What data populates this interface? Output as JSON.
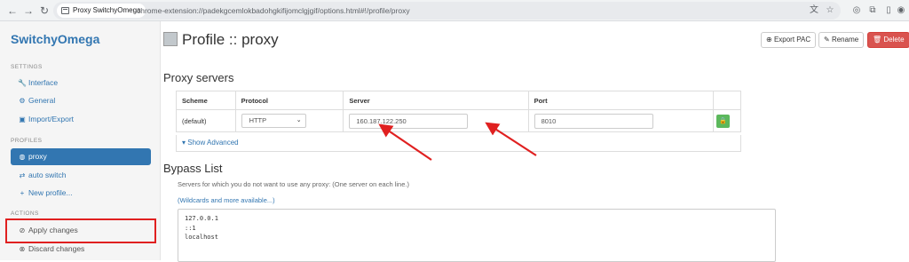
{
  "browser": {
    "tab_site_name": "Proxy SwitchyOmega",
    "url": "chrome-extension://padekgcemlokbadohgkifijomclgjgif/options.html#!/profile/proxy"
  },
  "sidebar": {
    "brand": "SwitchyOmega",
    "settings_header": "SETTINGS",
    "settings_items": [
      {
        "label": "Interface",
        "icon": "wrench-icon"
      },
      {
        "label": "General",
        "icon": "gear-icon"
      },
      {
        "label": "Import/Export",
        "icon": "floppy-icon"
      }
    ],
    "profiles_header": "PROFILES",
    "profile_items": [
      {
        "label": "proxy",
        "icon": "globe-icon",
        "active": true
      },
      {
        "label": "auto switch",
        "icon": "shuffle-icon"
      },
      {
        "label": "New profile...",
        "icon": "plus-icon"
      }
    ],
    "actions_header": "ACTIONS",
    "action_items": [
      {
        "label": "Apply changes",
        "icon": "check-circle-icon"
      },
      {
        "label": "Discard changes",
        "icon": "x-circle-icon"
      }
    ]
  },
  "header": {
    "title": "Profile :: proxy",
    "export_label": "Export PAC",
    "rename_label": "Rename",
    "delete_label": "Delete"
  },
  "proxy_servers": {
    "heading": "Proxy servers",
    "columns": [
      "Scheme",
      "Protocol",
      "Server",
      "Port"
    ],
    "row": {
      "scheme": "(default)",
      "protocol": "HTTP",
      "server": "160.187.122.250",
      "port": "8010"
    },
    "show_advanced": "Show Advanced"
  },
  "bypass": {
    "heading": "Bypass List",
    "description": "Servers for which you do not want to use any proxy: (One server on each line.)",
    "wildcards_link": "(Wildcards and more available...)",
    "lines": [
      "127.0.0.1",
      "::1",
      "localhost"
    ]
  },
  "colors": {
    "accent": "#3276b1",
    "danger": "#d9534f",
    "success": "#5cb85c",
    "annotation": "#e02020"
  }
}
